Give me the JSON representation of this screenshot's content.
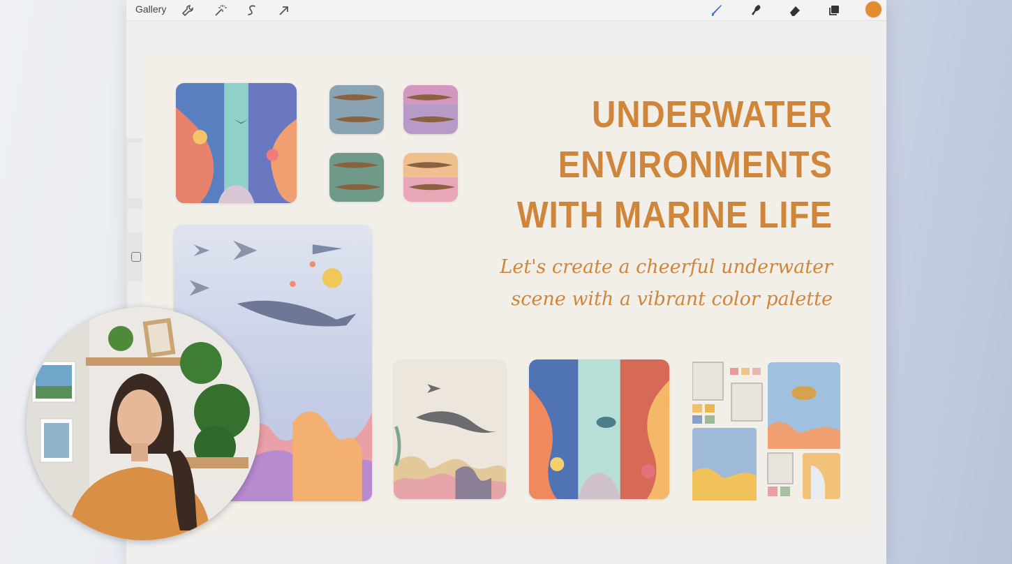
{
  "toolbar": {
    "gallery_label": "Gallery",
    "left_tools": [
      "wrench-icon",
      "magic-wand-icon",
      "selection-icon",
      "transform-arrow-icon"
    ],
    "right_tools": [
      "brush-icon",
      "smudge-icon",
      "eraser-icon",
      "layers-icon"
    ],
    "current_color": "#e38b2f"
  },
  "canvas": {
    "title": "UNDERWATER ENVIRONMENTS WITH MARINE LIFE",
    "subtitle": "Let's create a cheerful underwater scene with a vibrant color palette",
    "accent_color": "#cf853a",
    "background_color": "#f3efe9"
  },
  "webcam": {
    "subject": "presenter"
  }
}
